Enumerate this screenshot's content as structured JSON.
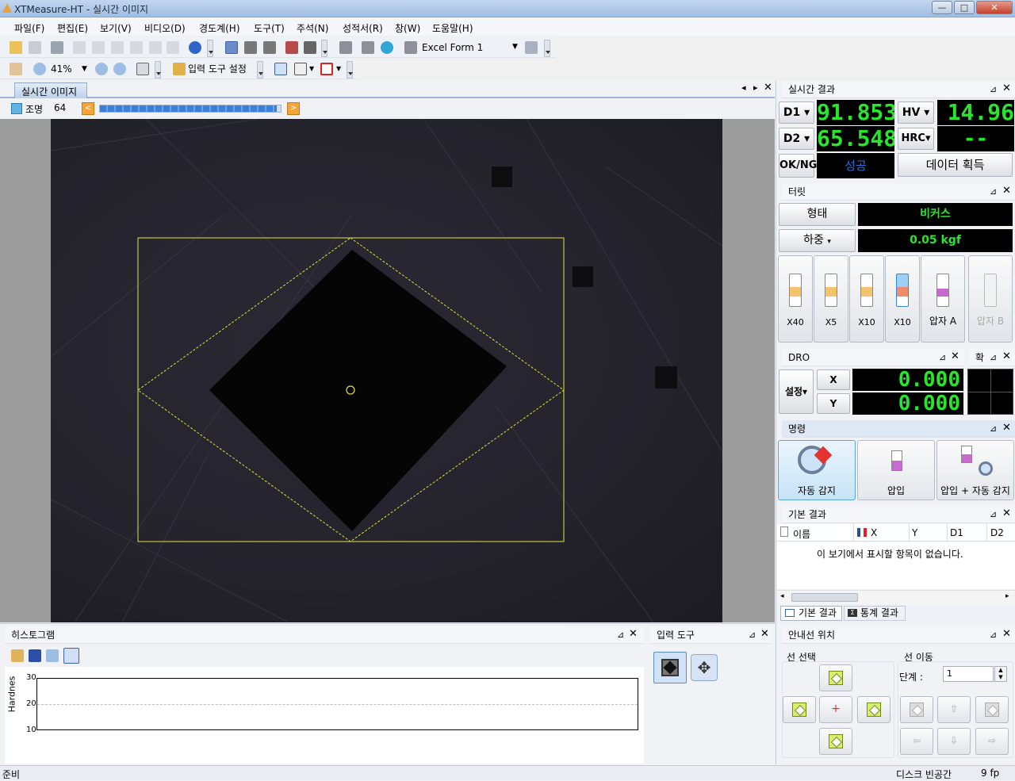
{
  "window": {
    "title": "XTMeasure-HT - 실시간 이미지",
    "min": "—",
    "max": "□",
    "close": "✕"
  },
  "menu": [
    "파일(F)",
    "편집(E)",
    "보기(V)",
    "비디오(D)",
    "경도계(H)",
    "도구(T)",
    "주석(N)",
    "성적서(R)",
    "창(W)",
    "도움말(H)"
  ],
  "toolbar": {
    "excel_form": "Excel Form 1",
    "zoom": "41%",
    "input_tool_settings": "입력 도구 설정"
  },
  "image_tab": {
    "label": "실시간 이미지",
    "scroll_left": "◂",
    "scroll_right": "▸",
    "close": "✕"
  },
  "lighting": {
    "label": "조명",
    "value": "64",
    "fraction": 0.98
  },
  "realtime_results": {
    "title": "실시간 결과",
    "d1_label": "D1",
    "d1_value": "91.853",
    "hv_label": "HV",
    "hv_value": "14.96",
    "d2_label": "D2",
    "d2_value": "65.548",
    "hrc_label": "HRC",
    "hrc_value": "--",
    "okng_label": "OK/NG",
    "okng_value": "성공",
    "acquire_button": "데이터 획득"
  },
  "turret": {
    "title": "터릿",
    "shape_label": "형태",
    "shape_value": "비커스",
    "load_label": "하중",
    "load_value": "0.05 kgf",
    "objectives": [
      "X40",
      "X5",
      "X10",
      "X10",
      "압자 A",
      "압자 B"
    ]
  },
  "dro": {
    "title": "DRO",
    "settings": "설정",
    "x_label": "X",
    "x_value": "0.000",
    "y_label": "Y",
    "y_value": "0.000",
    "side_tab": "확"
  },
  "commands": {
    "title": "명령",
    "auto_detect": "자동 감지",
    "indent": "압입",
    "indent_auto": "압입 + 자동 감지"
  },
  "basic_results": {
    "title": "기본 결과",
    "columns": [
      "이름",
      "X",
      "Y",
      "D1",
      "D2"
    ],
    "empty_message": "이 보기에서 표시할 항목이 없습니다.",
    "tab_basic": "기본 결과",
    "tab_stats": "통계 결과"
  },
  "histogram": {
    "title": "히스토그램",
    "ylabel": "Hardnes"
  },
  "chart_data": {
    "type": "line",
    "ylabel": "Hardnes",
    "ylim": [
      10,
      30
    ],
    "yticks": [
      "30",
      "20",
      "10"
    ],
    "series": []
  },
  "input_tool": {
    "title": "입력 도구"
  },
  "guide_position": {
    "title": "안내선 위치",
    "line_select": "선 선택",
    "line_move": "선 이동",
    "step_label": "단계 :",
    "step_value": "1"
  },
  "status": {
    "ready": "준비",
    "disk": "디스크 빈공간",
    "fps": "9 fp"
  },
  "panel": {
    "pin": "⊿",
    "close": "✕"
  }
}
